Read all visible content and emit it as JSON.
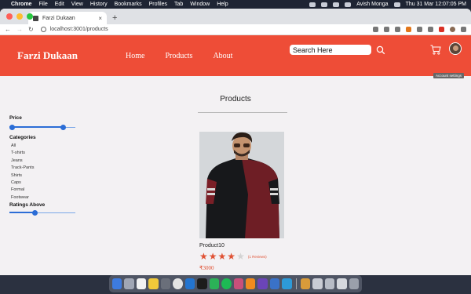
{
  "menubar": {
    "app": "Chrome",
    "items": [
      "File",
      "Edit",
      "View",
      "History",
      "Bookmarks",
      "Profiles",
      "Tab",
      "Window",
      "Help"
    ],
    "user": "Avish Monga",
    "datetime": "Thu 31 Mar  12:07:05 PM"
  },
  "browser": {
    "tab_title": "Farzi Dukaan",
    "url": "localhost:3001/products"
  },
  "header": {
    "logo": "Farzi Dukaan",
    "nav": [
      "Home",
      "Products",
      "About"
    ],
    "search_placeholder": "Search Here",
    "tooltip": "Account settings"
  },
  "page": {
    "title": "Products"
  },
  "filters": {
    "price_label": "Price",
    "price_range": [
      0,
      0.82
    ],
    "categories_label": "Categories",
    "categories": [
      "All",
      "T-shirts",
      "Jeans",
      "Track-Pants",
      "Shirts",
      "Caps",
      "Formal",
      "Footwear"
    ],
    "ratings_label": "Ratings Above",
    "ratings_value": 0.39
  },
  "products": [
    {
      "name": "Product10",
      "rating": 4,
      "max_rating": 5,
      "reviews": "(1 Reviews)",
      "price": "₹3000"
    }
  ],
  "colors": {
    "brand": "#ee4d37",
    "slider": "#2b6dd6",
    "star": "#e05234"
  }
}
